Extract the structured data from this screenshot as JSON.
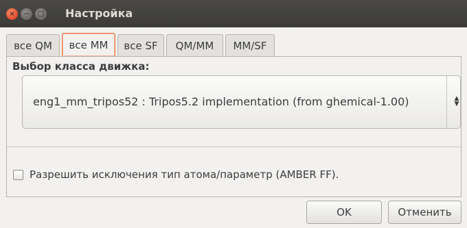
{
  "window": {
    "title": "Настройка",
    "close_glyph": "×",
    "min_glyph": "−",
    "max_glyph": "□"
  },
  "tabs": [
    {
      "label": "все QM",
      "active": false
    },
    {
      "label": "все MM",
      "active": true
    },
    {
      "label": "все SF",
      "active": false
    },
    {
      "label": "QM/MM",
      "active": false
    },
    {
      "label": "MM/SF",
      "active": false
    }
  ],
  "engine": {
    "label": "Выбор класса движка:",
    "selected": "eng1_mm_tripos52 : Tripos5.2 implementation (from ghemical-1.00)",
    "arrow_up": "▲",
    "arrow_down": "▼"
  },
  "options": {
    "amber_exceptions_label": "Разрешить исключения тип атома/параметр (AMBER FF).",
    "amber_exceptions_checked": false
  },
  "buttons": {
    "ok": "OK",
    "cancel": "Отменить"
  },
  "colors": {
    "titlebar": "#3c3b37",
    "close": "#e2492f",
    "active_tab_border": "#e9784a",
    "background": "#f2f1f0"
  }
}
